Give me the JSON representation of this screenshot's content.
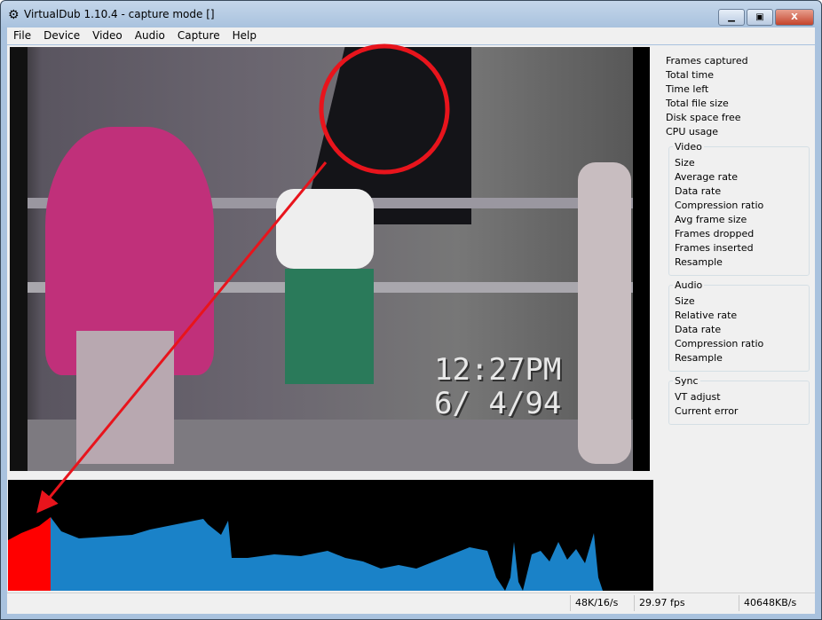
{
  "window": {
    "title": "VirtualDub 1.10.4 - capture mode []",
    "minimize": "▁",
    "maximize": "▣",
    "close": "X"
  },
  "menu": [
    "File",
    "Device",
    "Video",
    "Audio",
    "Capture",
    "Help"
  ],
  "video": {
    "timestamp": "12:27PM\n6/ 4/94"
  },
  "stats": {
    "top": [
      "Frames captured",
      "Total time",
      "Time left",
      "Total file size",
      "Disk space free",
      "CPU usage"
    ],
    "video": {
      "title": "Video",
      "items": [
        "Size",
        "Average rate",
        "Data rate",
        "Compression ratio",
        "Avg frame size",
        "Frames dropped",
        "Frames inserted",
        "Resample"
      ]
    },
    "audio": {
      "title": "Audio",
      "items": [
        "Size",
        "Relative rate",
        "Data rate",
        "Compression ratio",
        "Resample"
      ]
    },
    "sync": {
      "title": "Sync",
      "items": [
        "VT adjust",
        "Current error"
      ]
    }
  },
  "status": {
    "audio": "48K/16/s",
    "fps": "29.97 fps",
    "rate": "40648KB/s"
  },
  "colors": {
    "graph": "#1a82c8",
    "graph_recent": "#ff0000",
    "annotation": "#e8141c"
  }
}
